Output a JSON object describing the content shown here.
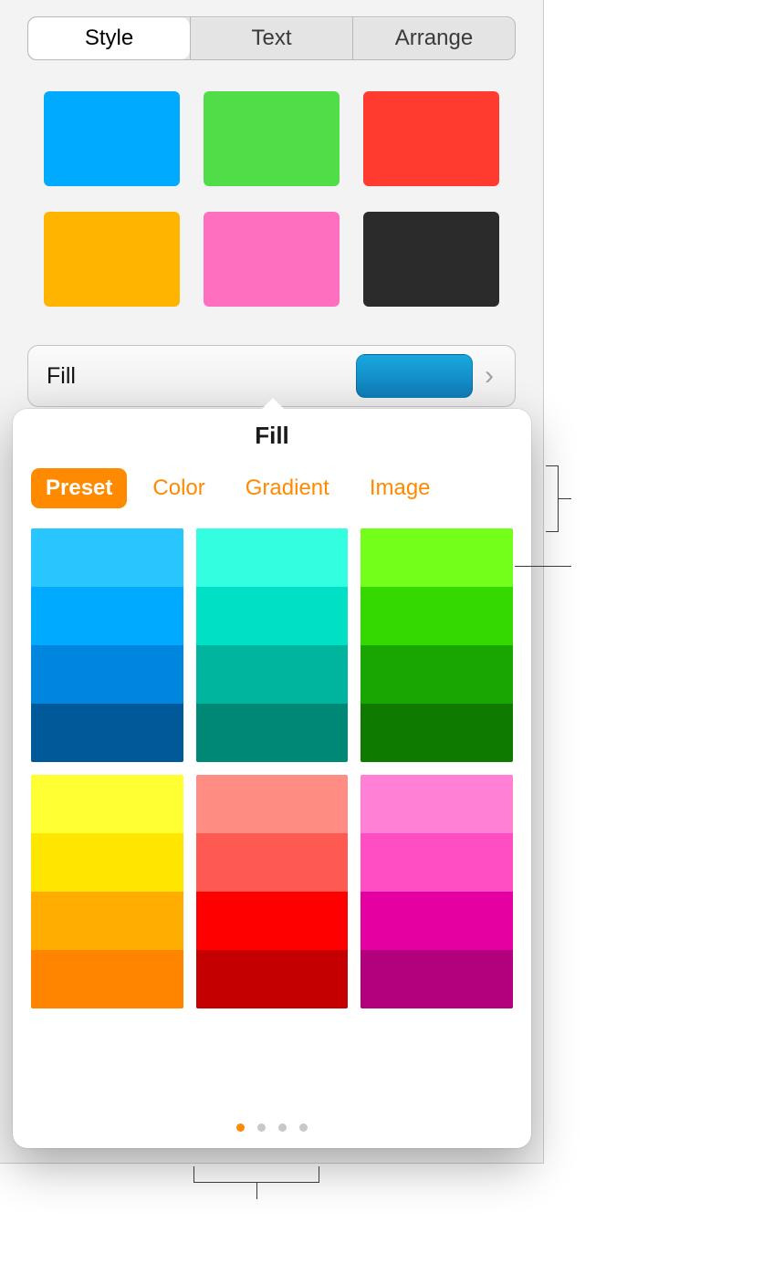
{
  "tabs": {
    "style": "Style",
    "text": "Text",
    "arrange": "Arrange"
  },
  "style_swatches": [
    "#00aaff",
    "#51dd47",
    "#ff3a2f",
    "#ffb400",
    "#ff6fbf",
    "#2b2b2b"
  ],
  "fill_row": {
    "label": "Fill"
  },
  "popover": {
    "title": "Fill",
    "segments": {
      "preset": "Preset",
      "color": "Color",
      "gradient": "Gradient",
      "image": "Image"
    },
    "preset_blocks": [
      [
        "#29c5ff",
        "#00aaff",
        "#0086de",
        "#005a99"
      ],
      [
        "#33ffe0",
        "#00e0c4",
        "#00b59e",
        "#008877"
      ],
      [
        "#73ff1a",
        "#33d900",
        "#1aa600",
        "#0f7a00"
      ],
      [
        "#ffff33",
        "#ffe600",
        "#ffad00",
        "#ff8500"
      ],
      [
        "#ff8d84",
        "#ff5a52",
        "#ff0000",
        "#c40000"
      ],
      [
        "#ff80d4",
        "#ff4dc3",
        "#e500a1",
        "#b3007d"
      ]
    ],
    "page_dots": {
      "count": 4,
      "active": 0
    }
  }
}
